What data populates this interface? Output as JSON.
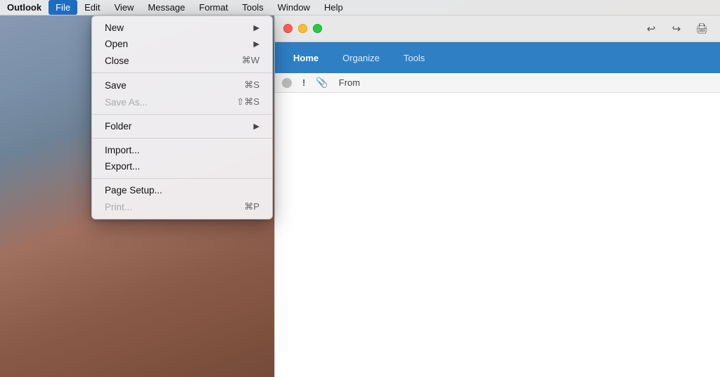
{
  "app": {
    "name": "Outlook"
  },
  "menubar": {
    "items": [
      {
        "id": "outlook",
        "label": "Outlook",
        "bold": true
      },
      {
        "id": "file",
        "label": "File",
        "active": true
      },
      {
        "id": "edit",
        "label": "Edit"
      },
      {
        "id": "view",
        "label": "View"
      },
      {
        "id": "message",
        "label": "Message"
      },
      {
        "id": "format",
        "label": "Format"
      },
      {
        "id": "tools",
        "label": "Tools"
      },
      {
        "id": "window",
        "label": "Window"
      },
      {
        "id": "help",
        "label": "Help"
      }
    ]
  },
  "file_menu": {
    "groups": [
      {
        "items": [
          {
            "id": "new",
            "label": "New",
            "shortcut": "▶",
            "has_arrow": true,
            "disabled": false
          },
          {
            "id": "open",
            "label": "Open",
            "shortcut": "▶",
            "has_arrow": true,
            "disabled": false
          },
          {
            "id": "close",
            "label": "Close",
            "shortcut": "⌘W",
            "has_arrow": false,
            "disabled": false
          }
        ]
      },
      {
        "items": [
          {
            "id": "save",
            "label": "Save",
            "shortcut": "⌘S",
            "has_arrow": false,
            "disabled": false
          },
          {
            "id": "save-as",
            "label": "Save As...",
            "shortcut": "⇧⌘S",
            "has_arrow": false,
            "disabled": true
          }
        ]
      },
      {
        "items": [
          {
            "id": "folder",
            "label": "Folder",
            "shortcut": "▶",
            "has_arrow": true,
            "disabled": false
          }
        ]
      },
      {
        "items": [
          {
            "id": "import",
            "label": "Import...",
            "shortcut": "",
            "has_arrow": false,
            "disabled": false
          },
          {
            "id": "export",
            "label": "Export...",
            "shortcut": "",
            "has_arrow": false,
            "disabled": false
          }
        ]
      },
      {
        "items": [
          {
            "id": "page-setup",
            "label": "Page Setup...",
            "shortcut": "",
            "has_arrow": false,
            "disabled": false
          },
          {
            "id": "print",
            "label": "Print...",
            "shortcut": "⌘P",
            "has_arrow": false,
            "disabled": true
          }
        ]
      }
    ]
  },
  "toolbar": {
    "undo_label": "↩",
    "redo_label": "↪",
    "print_label": "🖨"
  },
  "ribbon": {
    "tabs": [
      {
        "id": "home",
        "label": "Home",
        "active": true
      },
      {
        "id": "organize",
        "label": "Organize",
        "active": false
      },
      {
        "id": "tools",
        "label": "Tools",
        "active": false
      }
    ]
  },
  "column_headers": {
    "columns": [
      {
        "id": "status",
        "type": "circle"
      },
      {
        "id": "priority",
        "label": "!"
      },
      {
        "id": "attachment",
        "label": "📎"
      },
      {
        "id": "from",
        "label": "From"
      }
    ]
  },
  "traffic_lights": {
    "close": "close",
    "minimize": "minimize",
    "maximize": "maximize"
  }
}
